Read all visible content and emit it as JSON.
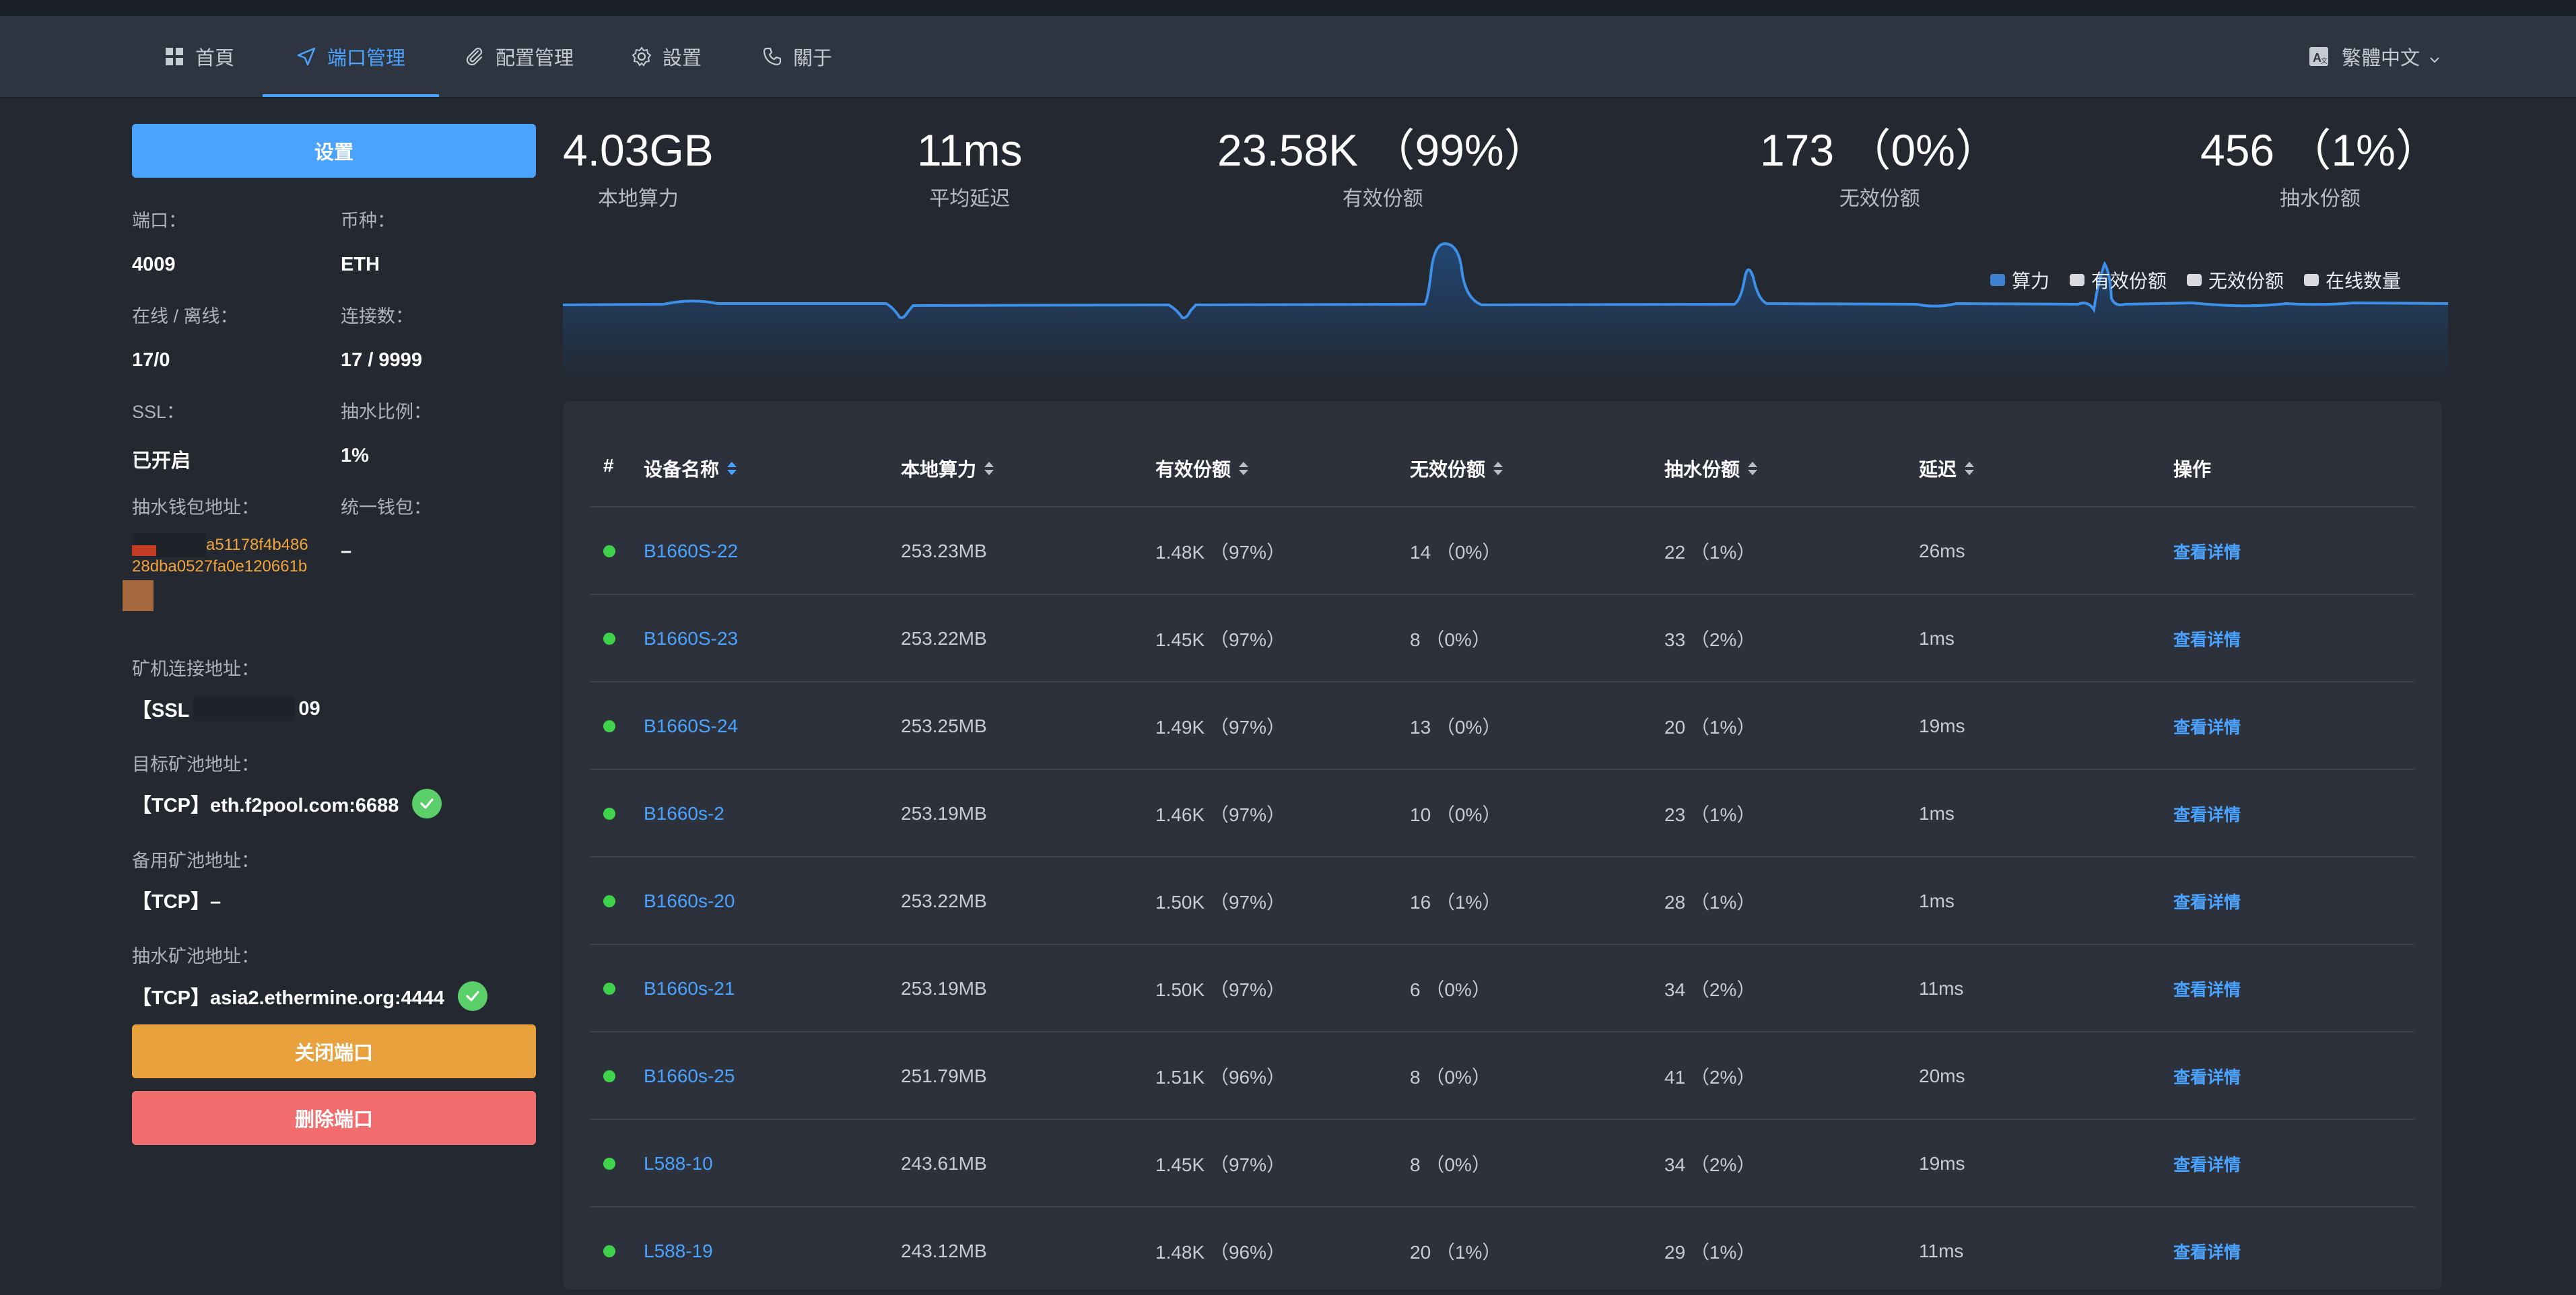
{
  "nav": {
    "items": [
      {
        "label": "首頁",
        "icon": "grid-icon"
      },
      {
        "label": "端口管理",
        "icon": "send-icon"
      },
      {
        "label": "配置管理",
        "icon": "paperclip-icon"
      },
      {
        "label": "設置",
        "icon": "gear-icon"
      },
      {
        "label": "關于",
        "icon": "phone-icon"
      }
    ],
    "active_index": 1,
    "language": "繁體中文"
  },
  "colors": {
    "accent": "#4aa3ff",
    "warning": "#e8a13c",
    "danger": "#f26e6e",
    "success": "#5bd06a",
    "wallet": "#f2a33a"
  },
  "sidebar": {
    "settings_button": "设置",
    "port_label": "端口：",
    "port_value": "4009",
    "coin_label": "币种：",
    "coin_value": "ETH",
    "online_label": "在线 / 离线：",
    "online_value": "17/0",
    "conn_label": "连接数：",
    "conn_value": "17 / 9999",
    "ssl_label": "SSL：",
    "ssl_value": "已开启",
    "ratio_label": "抽水比例：",
    "ratio_value": "1%",
    "wallet_label": "抽水钱包地址：",
    "wallet_line1": "a51178f4b486",
    "wallet_line2": "28dba0527fa0e120661b",
    "unified_label": "统一钱包：",
    "unified_value": "–",
    "miner_label": "矿机连接地址：",
    "miner_value_prefix": "【SSL",
    "miner_value_suffix": "09",
    "target_label": "目标矿池地址：",
    "target_value": "【TCP】eth.f2pool.com:6688",
    "backup_label": "备用矿池地址：",
    "backup_value": "【TCP】–",
    "fee_pool_label": "抽水矿池地址：",
    "fee_pool_value": "【TCP】asia2.ethermine.org:4444",
    "close_button": "关闭端口",
    "delete_button": "删除端口"
  },
  "stats": [
    {
      "value": "4.03GB",
      "label": "本地算力"
    },
    {
      "value": "11ms",
      "label": "平均延迟"
    },
    {
      "value": "23.58K （99%）",
      "label": "有效份额"
    },
    {
      "value": "173 （0%）",
      "label": "无效份额"
    },
    {
      "value": "456 （1%）",
      "label": "抽水份额"
    }
  ],
  "legend": [
    {
      "label": "算力",
      "color": "#3d7fd0"
    },
    {
      "label": "有效份额",
      "color": "#d8dadf"
    },
    {
      "label": "无效份额",
      "color": "#d8dadf"
    },
    {
      "label": "在线数量",
      "color": "#d8dadf"
    }
  ],
  "chart_data": {
    "type": "area",
    "series": [
      {
        "name": "算力",
        "values": [
          0.5,
          0.5,
          0.5,
          0.5,
          0.5,
          0.5,
          0.5,
          0.5,
          0.5,
          0.5,
          0.5,
          0.5,
          0.5,
          0.5,
          0.5,
          0.5,
          0.5,
          0.5,
          0.5,
          0.5,
          0.5,
          0.5,
          0.5,
          0.5,
          0.5,
          0.5,
          0.5,
          0.5,
          0.5,
          0.5,
          0.5,
          0.5,
          0.5,
          0.5,
          0.5,
          0.5,
          0.5,
          0.5,
          0.5,
          0.5,
          0.5,
          0.5,
          0.5,
          0.5,
          0.5,
          0.5,
          0.5,
          0.5,
          0.5,
          0.5,
          0.5,
          0.5,
          0.5,
          0.5,
          0.5,
          0.5,
          0.5,
          0.5,
          0.5,
          0.5
        ]
      }
    ]
  },
  "table": {
    "headers": [
      "#",
      "设备名称",
      "本地算力",
      "有效份额",
      "无效份额",
      "抽水份额",
      "延迟",
      "操作"
    ],
    "rows": [
      {
        "name": "B1660S-22",
        "hash": "253.23MB",
        "valid": "1.48K （97%）",
        "invalid": "14 （0%）",
        "fee": "22 （1%）",
        "latency": "26ms",
        "action": "查看详情"
      },
      {
        "name": "B1660S-23",
        "hash": "253.22MB",
        "valid": "1.45K （97%）",
        "invalid": "8 （0%）",
        "fee": "33 （2%）",
        "latency": "1ms",
        "action": "查看详情"
      },
      {
        "name": "B1660S-24",
        "hash": "253.25MB",
        "valid": "1.49K （97%）",
        "invalid": "13 （0%）",
        "fee": "20 （1%）",
        "latency": "19ms",
        "action": "查看详情"
      },
      {
        "name": "B1660s-2",
        "hash": "253.19MB",
        "valid": "1.46K （97%）",
        "invalid": "10 （0%）",
        "fee": "23 （1%）",
        "latency": "1ms",
        "action": "查看详情"
      },
      {
        "name": "B1660s-20",
        "hash": "253.22MB",
        "valid": "1.50K （97%）",
        "invalid": "16 （1%）",
        "fee": "28 （1%）",
        "latency": "1ms",
        "action": "查看详情"
      },
      {
        "name": "B1660s-21",
        "hash": "253.19MB",
        "valid": "1.50K （97%）",
        "invalid": "6 （0%）",
        "fee": "34 （2%）",
        "latency": "11ms",
        "action": "查看详情"
      },
      {
        "name": "B1660s-25",
        "hash": "251.79MB",
        "valid": "1.51K （96%）",
        "invalid": "8 （0%）",
        "fee": "41 （2%）",
        "latency": "20ms",
        "action": "查看详情"
      },
      {
        "name": "L588-10",
        "hash": "243.61MB",
        "valid": "1.45K （97%）",
        "invalid": "8 （0%）",
        "fee": "34 （2%）",
        "latency": "19ms",
        "action": "查看详情"
      },
      {
        "name": "L588-19",
        "hash": "243.12MB",
        "valid": "1.48K （96%）",
        "invalid": "20 （1%）",
        "fee": "29 （1%）",
        "latency": "11ms",
        "action": "查看详情"
      }
    ]
  }
}
